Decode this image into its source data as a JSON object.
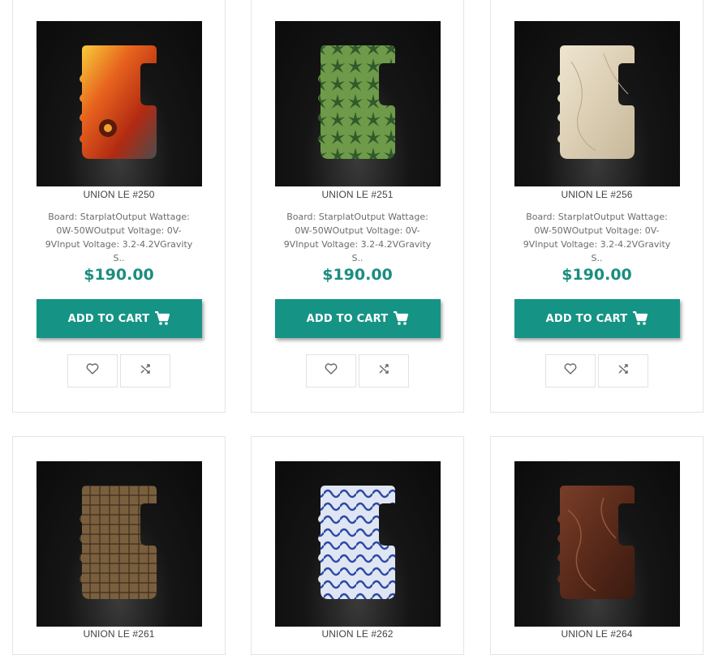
{
  "products": [
    {
      "name": "UNION LE #250",
      "desc": [
        "Board: StarplatOutput Wattage:",
        "0W-50WOutput Voltage: 0V-",
        "9VInput Voltage: 3.2-4.2VGravity",
        "S.."
      ],
      "price": "$190.00",
      "cart_label": "ADD TO CART",
      "image": "flame-skull"
    },
    {
      "name": "UNION LE #251",
      "desc": [
        "Board: StarplatOutput Wattage:",
        "0W-50WOutput Voltage: 0V-",
        "9VInput Voltage: 3.2-4.2VGravity",
        "S.."
      ],
      "price": "$190.00",
      "cart_label": "ADD TO CART",
      "image": "green-leaf"
    },
    {
      "name": "UNION LE #256",
      "desc": [
        "Board: StarplatOutput Wattage:",
        "0W-50WOutput Voltage: 0V-",
        "9VInput Voltage: 3.2-4.2VGravity",
        "S.."
      ],
      "price": "$190.00",
      "cart_label": "ADD TO CART",
      "image": "cream-marble"
    },
    {
      "name": "UNION LE #261",
      "image": "bronze-croc"
    },
    {
      "name": "UNION LE #262",
      "image": "blue-wave"
    },
    {
      "name": "UNION LE #264",
      "image": "brown-wood"
    }
  ],
  "icons": {
    "cart": "cart-icon",
    "wishlist": "heart-icon",
    "compare": "shuffle-icon"
  },
  "colors": {
    "accent": "#159485",
    "price": "#1a8e7f"
  }
}
